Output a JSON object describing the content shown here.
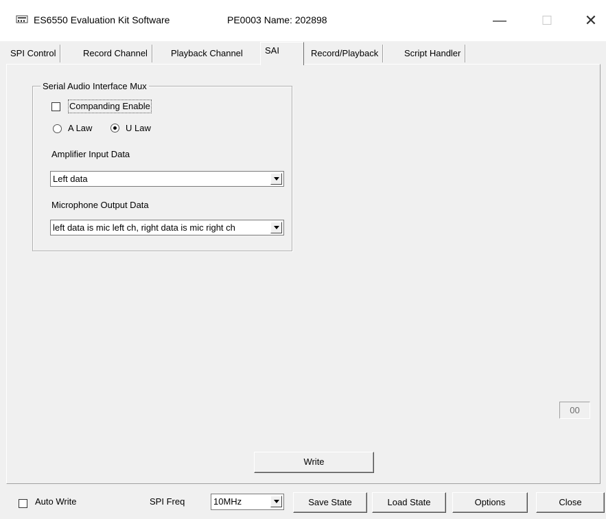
{
  "window": {
    "title": "ES6550 Evaluation Kit Software",
    "node_name": "PE0003 Name: 202898",
    "controls": {
      "minimize": "—",
      "maximize": "☐",
      "close": "✕"
    }
  },
  "tabs": [
    {
      "label": "SPI Control",
      "active": false
    },
    {
      "label": "Record Channel",
      "active": false
    },
    {
      "label": "Playback Channel",
      "active": false
    },
    {
      "label": "SAI",
      "active": true
    },
    {
      "label": "Record/Playback",
      "active": false
    },
    {
      "label": "Script Handler",
      "active": false
    }
  ],
  "sai": {
    "group_title": "Serial Audio Interface Mux",
    "companding": {
      "label": "Companding Enable",
      "checked": false
    },
    "law": {
      "options": [
        "A Law",
        "U Law"
      ],
      "selected": "U Law"
    },
    "amplifier_input": {
      "label": "Amplifier Input Data",
      "value": "Left data"
    },
    "microphone_output": {
      "label": "Microphone Output Data",
      "value": "left data is mic left ch, right data is mic right ch"
    },
    "status_value": "00",
    "write_label": "Write"
  },
  "footer": {
    "auto_write": {
      "label": "Auto Write",
      "checked": false
    },
    "spi_freq": {
      "label": "SPI Freq",
      "value": "10MHz"
    },
    "save_state": "Save State",
    "load_state": "Load State",
    "options": "Options",
    "close": "Close"
  }
}
